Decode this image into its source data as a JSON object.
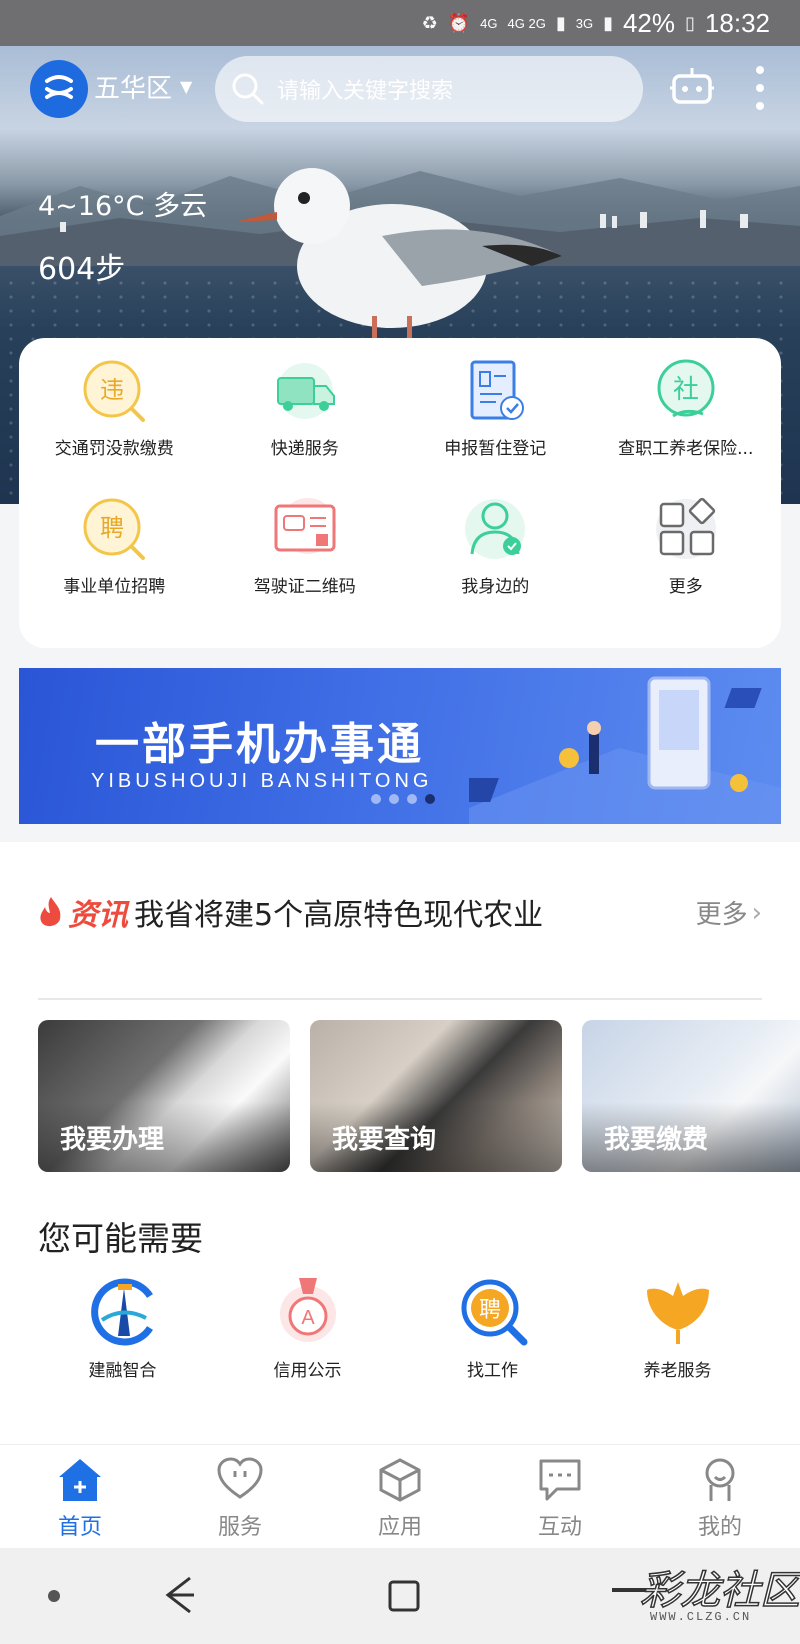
{
  "status_bar": {
    "battery": "42%",
    "time": "18:32",
    "network_1": "4G",
    "network_2": "4G 2G",
    "network_3": "3G"
  },
  "header": {
    "region": "五华区",
    "search_placeholder": "请输入关键字搜索"
  },
  "hero": {
    "weather": "4~16°C  多云",
    "steps": "604步"
  },
  "services": [
    {
      "label": "交通罚没款缴费",
      "icon": "violation-icon",
      "color": "#f3c64a"
    },
    {
      "label": "快递服务",
      "icon": "delivery-truck-icon",
      "color": "#3ccf9a"
    },
    {
      "label": "申报暂住登记",
      "icon": "residence-register-icon",
      "color": "#3b7fe6"
    },
    {
      "label": "查职工养老保险...",
      "icon": "social-security-icon",
      "color": "#3ccf9a"
    },
    {
      "label": "事业单位招聘",
      "icon": "recruit-icon",
      "color": "#f3c64a"
    },
    {
      "label": "驾驶证二维码",
      "icon": "driver-license-qr-icon",
      "color": "#f07777"
    },
    {
      "label": "我身边的",
      "icon": "person-nearby-icon",
      "color": "#3ccf9a"
    },
    {
      "label": "更多",
      "icon": "more-grid-icon",
      "color": "#7a7a7a"
    }
  ],
  "banner": {
    "title": "一部手机办事通",
    "subtitle": "YIBUSHOUJI BANSHITONG"
  },
  "news": {
    "tag": "资讯",
    "headline": "我省将建5个高原特色现代农业",
    "more": "更多"
  },
  "tiles": [
    {
      "label": "我要办理"
    },
    {
      "label": "我要查询"
    },
    {
      "label": "我要缴费"
    }
  ],
  "maybe": {
    "title": "您可能需要",
    "items": [
      {
        "label": "建融智合",
        "icon": "jianrong-icon"
      },
      {
        "label": "信用公示",
        "icon": "credit-medal-icon"
      },
      {
        "label": "找工作",
        "icon": "job-search-icon"
      },
      {
        "label": "养老服务",
        "icon": "ginkgo-leaf-icon"
      }
    ]
  },
  "tabbar": [
    {
      "label": "首页",
      "icon": "home-icon",
      "active": true
    },
    {
      "label": "服务",
      "icon": "heart-service-icon"
    },
    {
      "label": "应用",
      "icon": "cube-icon"
    },
    {
      "label": "互动",
      "icon": "chat-icon"
    },
    {
      "label": "我的",
      "icon": "user-icon"
    }
  ],
  "watermark": {
    "text": "彩龙社区",
    "url": "WWW.CLZG.CN"
  },
  "colors": {
    "brand": "#1f6fe5",
    "accent_red": "#ee4b3f"
  }
}
